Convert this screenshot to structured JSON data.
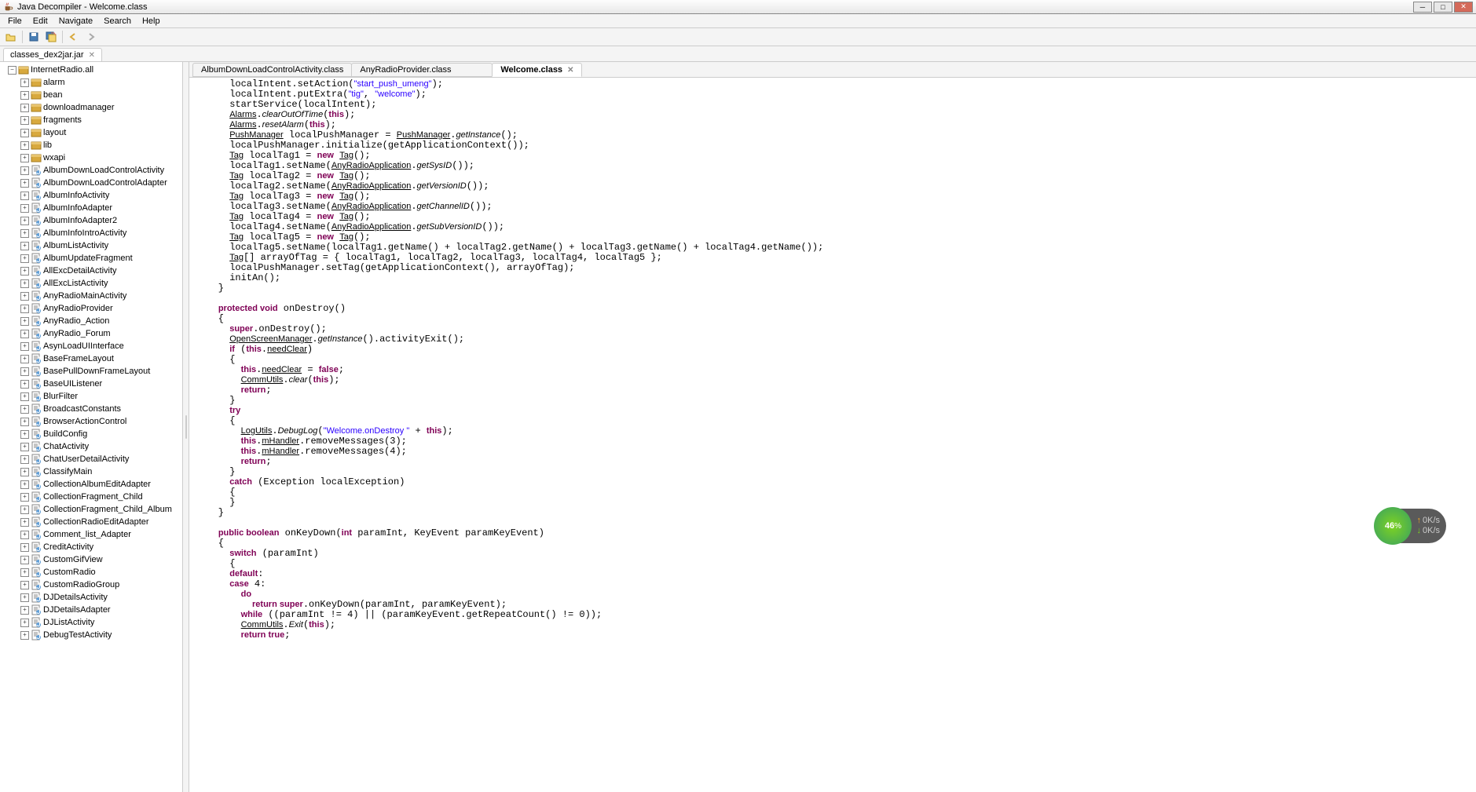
{
  "window": {
    "title": "Java Decompiler - Welcome.class"
  },
  "menu": [
    "File",
    "Edit",
    "Navigate",
    "Search",
    "Help"
  ],
  "file_tab": "classes_dex2jar.jar",
  "tree_root": "InternetRadio.all",
  "packages": [
    "alarm",
    "bean",
    "downloadmanager",
    "fragments",
    "layout",
    "lib",
    "wxapi"
  ],
  "classes": [
    "AlbumDownLoadControlActivity",
    "AlbumDownLoadControlAdapter",
    "AlbumInfoActivity",
    "AlbumInfoAdapter",
    "AlbumInfoAdapter2",
    "AlbumInfoIntroActivity",
    "AlbumListActivity",
    "AlbumUpdateFragment",
    "AllExcDetailActivity",
    "AllExcListActivity",
    "AnyRadioMainActivity",
    "AnyRadioProvider",
    "AnyRadio_Action",
    "AnyRadio_Forum",
    "AsynLoadUIInterface",
    "BaseFrameLayout",
    "BasePullDownFrameLayout",
    "BaseUIListener",
    "BlurFilter",
    "BroadcastConstants",
    "BrowserActionControl",
    "BuildConfig",
    "ChatActivity",
    "ChatUserDetailActivity",
    "ClassifyMain",
    "CollectionAlbumEditAdapter",
    "CollectionFragment_Child",
    "CollectionFragment_Child_Album",
    "CollectionRadioEditAdapter",
    "Comment_list_Adapter",
    "CreditActivity",
    "CustomGifView",
    "CustomRadio",
    "CustomRadioGroup",
    "DJDetailsActivity",
    "DJDetailsAdapter",
    "DJListActivity",
    "DebugTestActivity"
  ],
  "editor_tabs": [
    {
      "label": "AlbumDownLoadControlActivity.class",
      "active": false
    },
    {
      "label": "AnyRadioProvider.class",
      "active": false
    },
    {
      "label": "Welcome.class",
      "active": true
    }
  ],
  "overlay": {
    "pct": "46",
    "pct_sym": "%",
    "up": "0K/s",
    "down": "0K/s"
  }
}
